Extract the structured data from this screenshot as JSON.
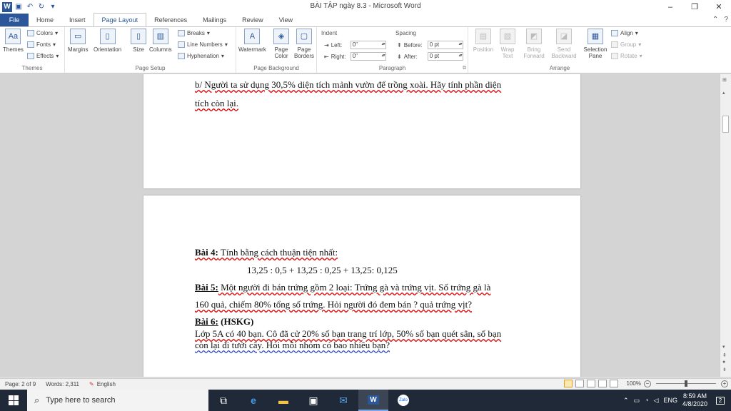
{
  "window": {
    "title": "BÀI TẬP ngày 8.3  -  Microsoft Word",
    "minimize": "–",
    "restore": "❐",
    "close": "✕"
  },
  "tabs": [
    {
      "label": "File"
    },
    {
      "label": "Home"
    },
    {
      "label": "Insert"
    },
    {
      "label": "Page Layout"
    },
    {
      "label": "References"
    },
    {
      "label": "Mailings"
    },
    {
      "label": "Review"
    },
    {
      "label": "View"
    }
  ],
  "ribbon": {
    "themes": {
      "themes_label": "Themes",
      "colors": "Colors",
      "fonts": "Fonts",
      "effects": "Effects",
      "group": "Themes"
    },
    "page_setup": {
      "margins": "Margins",
      "orientation": "Orientation",
      "size": "Size",
      "columns": "Columns",
      "breaks": "Breaks",
      "line_numbers": "Line Numbers",
      "hyphenation": "Hyphenation",
      "group": "Page Setup"
    },
    "page_background": {
      "watermark": "Watermark",
      "page_color": "Page Color",
      "page_borders": "Page Borders",
      "group": "Page Background"
    },
    "paragraph": {
      "indent_title": "Indent",
      "left_label": "Left:",
      "left_value": "0\"",
      "right_label": "Right:",
      "right_value": "0\"",
      "spacing_title": "Spacing",
      "before_label": "Before:",
      "before_value": "0 pt",
      "after_label": "After:",
      "after_value": "0 pt",
      "group": "Paragraph"
    },
    "arrange": {
      "position": "Position",
      "wrap_text": "Wrap Text",
      "bring_forward": "Bring Forward",
      "send_backward": "Send Backward",
      "selection_pane": "Selection Pane",
      "align": "Align",
      "group_btn": "Group",
      "rotate": "Rotate",
      "group": "Arrange"
    }
  },
  "document": {
    "page1_line1": "b/ Người ta sử dụng 30,5% diện tích mảnh vườn để trồng xoài. Hãy tính phần diện",
    "page1_line2": "tích còn lại.",
    "bai4_label": "Bài 4:",
    "bai4_text": " Tính bằng cách thuận tiện nhất:",
    "bai4_expr": "13,25 : 0,5  + 13,25 : 0,25  +  13,25: 0,125",
    "bai5_label": "Bài 5:",
    "bai5_text": " Một người đi bán trứng gồm 2 loại: Trứng gà và trứng vịt. Số trứng gà là",
    "bai5_line2": "160 quả, chiếm 80% tổng số trứng. Hỏi người đó đem bán ? quả trứng vịt?",
    "bai6_label": "Bài 6:",
    "bai6_tag": " (HSKG)",
    "bai6_line1": " Lớp 5A có 40 bạn. Cô đã cử 20% số bạn trang trí lớp, 50% số bạn quét sân, số bạn",
    "bai6_line2": "còn lại đi tưới cây. Hỏi mỗi nhóm có bao nhiêu bạn?"
  },
  "statusbar": {
    "page": "Page: 2 of 9",
    "words": "Words: 2,311",
    "language": "English",
    "zoom": "100%",
    "zoom_level_percent": 100
  },
  "taskbar": {
    "search_placeholder": "Type here to search",
    "lang": "ENG",
    "time": "8:59 AM",
    "date": "4/8/2020",
    "notif_count": "2"
  }
}
